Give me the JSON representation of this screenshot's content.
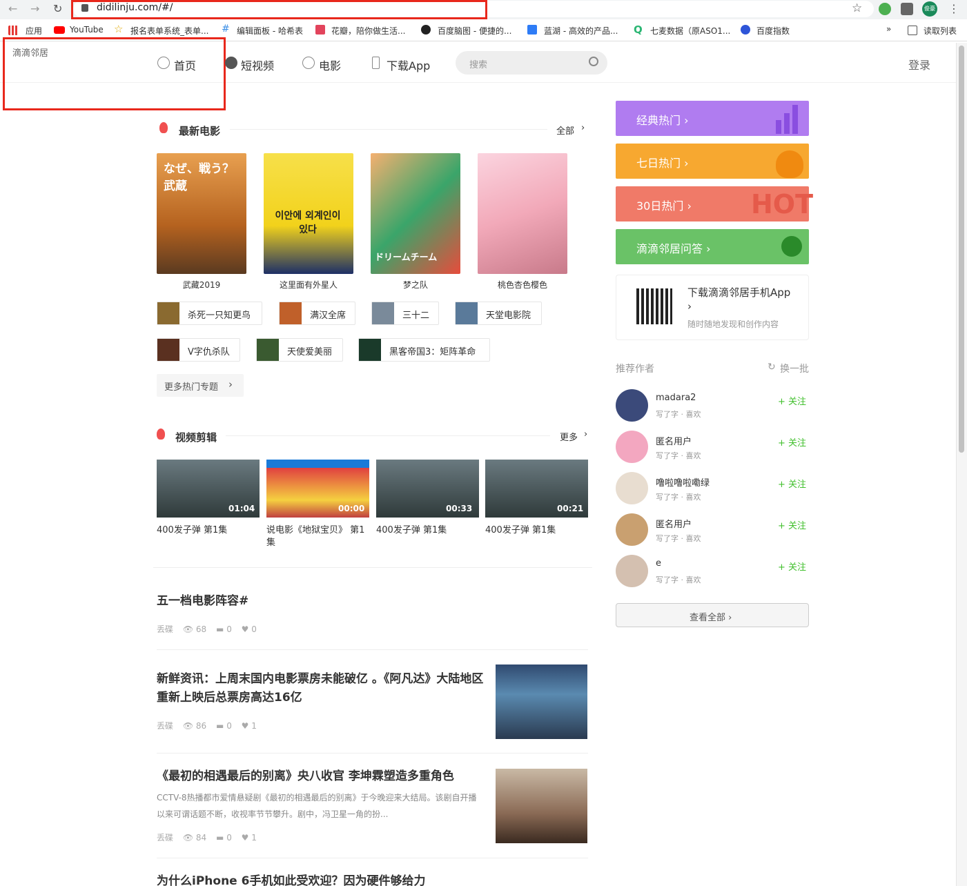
{
  "browser": {
    "url": "didilinju.com/#/",
    "profile": "俊豪",
    "bookmarks": [
      {
        "label": "应用"
      },
      {
        "label": "YouTube"
      },
      {
        "label": "报名表单系统_表单..."
      },
      {
        "label": "编辑面板 - 哈希表"
      },
      {
        "label": "花瓣，陪你做生活..."
      },
      {
        "label": "百度脑图 - 便捷的..."
      },
      {
        "label": "蓝湖 - 高效的产品..."
      },
      {
        "label": "七麦数据（原ASO1..."
      },
      {
        "label": "百度指数"
      },
      {
        "label": "读取列表"
      }
    ],
    "more_bookmarks": "»"
  },
  "header": {
    "logo_alt": "滴滴邻居",
    "nav": [
      {
        "label": "首页"
      },
      {
        "label": "短视频"
      },
      {
        "label": "电影"
      },
      {
        "label": "下载App"
      }
    ],
    "search_placeholder": "搜索",
    "login": "登录"
  },
  "movies": {
    "title": "最新电影",
    "more": "全部",
    "posters": [
      {
        "caption": "武藏2019",
        "text": "なぜ、戦う？ 武蔵",
        "color": "#b5621f"
      },
      {
        "caption": "这里面有外星人",
        "text": "이안에 외계인이 있다",
        "color": "#f2d21b"
      },
      {
        "caption": "梦之队",
        "text": "ドリームチーム",
        "color": "#3aa56a"
      },
      {
        "caption": "桃色杏色樱色",
        "text": "",
        "color": "#f2a9b9"
      }
    ],
    "tags": [
      {
        "label": "杀死一只知更鸟"
      },
      {
        "label": "满汉全席"
      },
      {
        "label": "三十二"
      },
      {
        "label": "天堂电影院"
      },
      {
        "label": "V字仇杀队"
      },
      {
        "label": "天使爱美丽"
      },
      {
        "label": "黑客帝国3：矩阵革命"
      }
    ],
    "more_topics": "更多热门专题"
  },
  "videos": {
    "title": "视频剪辑",
    "more": "更多",
    "items": [
      {
        "caption": "400发子弹 第1集",
        "duration": "01:04"
      },
      {
        "caption": "说电影《地狱宝贝》 第1集",
        "duration": "00:00"
      },
      {
        "caption": "400发子弹 第1集",
        "duration": "00:33"
      },
      {
        "caption": "400发子弹 第1集",
        "duration": "00:21"
      }
    ]
  },
  "articles": [
    {
      "title": "五一档电影阵容#",
      "author": "丢碟",
      "views": "68",
      "comments": "0",
      "likes": "0"
    },
    {
      "title": "新鲜资讯：上周末国内电影票房未能破亿 。《阿凡达》大陆地区重新上映后总票房高达16亿",
      "author": "丢碟",
      "views": "86",
      "comments": "0",
      "likes": "1"
    },
    {
      "title": "《最初的相遇最后的别离》央八收官 李坤霖塑造多重角色",
      "desc": "CCTV-8热播都市爱情悬疑剧《最初的相遇最后的别离》于今晚迎来大结局。该剧自开播以来可谓话题不断，收视率节节攀升。剧中，冯卫星一角的扮...",
      "author": "丢碟",
      "views": "84",
      "comments": "0",
      "likes": "1"
    },
    {
      "title": "为什么iPhone 6手机如此受欢迎？因为硬件够给力"
    }
  ],
  "sidebar": {
    "promos": [
      {
        "label": "经典热门 ›",
        "color": "#b07cf0"
      },
      {
        "label": "七日热门 ›",
        "color": "#f7a830"
      },
      {
        "label": "30日热门 ›",
        "color": "#f07a68"
      },
      {
        "label": "滴滴邻居问答 ›",
        "color": "#6ac267"
      }
    ],
    "promo_badge": "HOT",
    "download": {
      "title": "下载滴滴邻居手机App",
      "arrow": "›",
      "subtitle": "随时随地发现和创作内容"
    },
    "rec_title": "推荐作者",
    "refresh": "换一批",
    "authors": [
      {
        "name": "madara2",
        "meta": "写了字 · 喜欢",
        "follow": "+ 关注",
        "color": "#3b4a7a"
      },
      {
        "name": "匿名用户",
        "meta": "写了字 · 喜欢",
        "follow": "+ 关注",
        "color": "#f3a7c0"
      },
      {
        "name": "噜啦噜啦嘞绿",
        "meta": "写了字 · 喜欢",
        "follow": "+ 关注",
        "color": "#e8ddd0"
      },
      {
        "name": "匿名用户",
        "meta": "写了字 · 喜欢",
        "follow": "+ 关注",
        "color": "#c9a070"
      },
      {
        "name": "e",
        "meta": "写了字 · 喜欢",
        "follow": "+ 关注",
        "color": "#d4c0b0"
      }
    ],
    "view_all": "查看全部 ›"
  }
}
